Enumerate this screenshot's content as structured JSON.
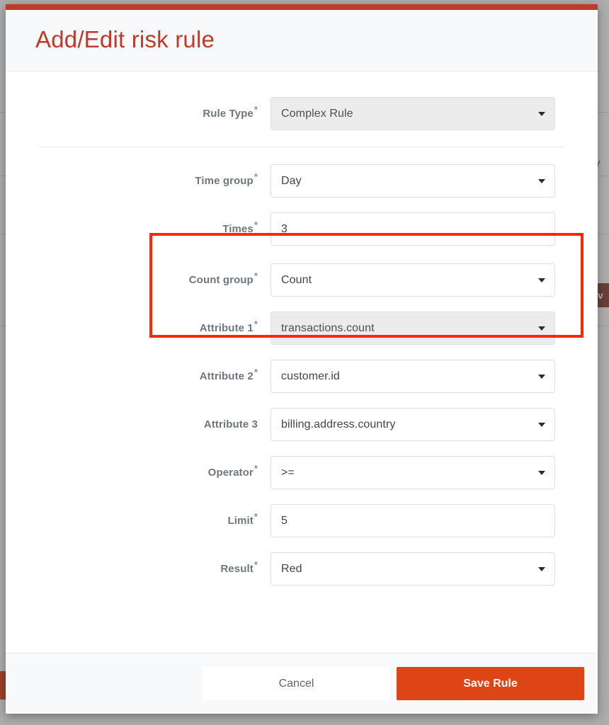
{
  "background": {
    "partial_text": "y",
    "partial_button_label": "v"
  },
  "modal": {
    "title": "Add/Edit risk rule",
    "accent_color": "#c0392b",
    "highlight_color": "#fa2800",
    "save_button_color": "#dd4516",
    "fields": [
      {
        "label": "Rule Type",
        "required": true,
        "value": "Complex Rule",
        "control": "select",
        "disabled": true,
        "caret": "chevron-down-icon"
      },
      {
        "label": "Time group",
        "required": true,
        "value": "Day",
        "control": "select",
        "disabled": false,
        "caret": "chevron-down-icon"
      },
      {
        "label": "Times",
        "required": true,
        "value": "3",
        "control": "text",
        "disabled": false,
        "caret": null
      },
      {
        "label": "Count group",
        "required": true,
        "value": "Count",
        "control": "select",
        "disabled": false,
        "caret": "chevron-down-icon"
      },
      {
        "label": "Attribute 1",
        "required": true,
        "value": "transactions.count",
        "control": "select",
        "disabled": true,
        "caret": "chevron-down-icon"
      },
      {
        "label": "Attribute 2",
        "required": true,
        "value": "customer.id",
        "control": "select",
        "disabled": false,
        "caret": "chevron-down-icon"
      },
      {
        "label": "Attribute 3",
        "required": false,
        "value": "billing.address.country",
        "control": "select",
        "disabled": false,
        "caret": "chevron-down-icon"
      },
      {
        "label": "Operator",
        "required": true,
        "value": ">=",
        "control": "select",
        "disabled": false,
        "caret": "chevron-down-icon"
      },
      {
        "label": "Limit",
        "required": true,
        "value": "5",
        "control": "text",
        "disabled": false,
        "caret": null
      },
      {
        "label": "Result",
        "required": true,
        "value": "Red",
        "control": "select",
        "disabled": false,
        "caret": "chevron-down-icon"
      }
    ],
    "footer": {
      "cancel_label": "Cancel",
      "save_label": "Save Rule"
    }
  }
}
